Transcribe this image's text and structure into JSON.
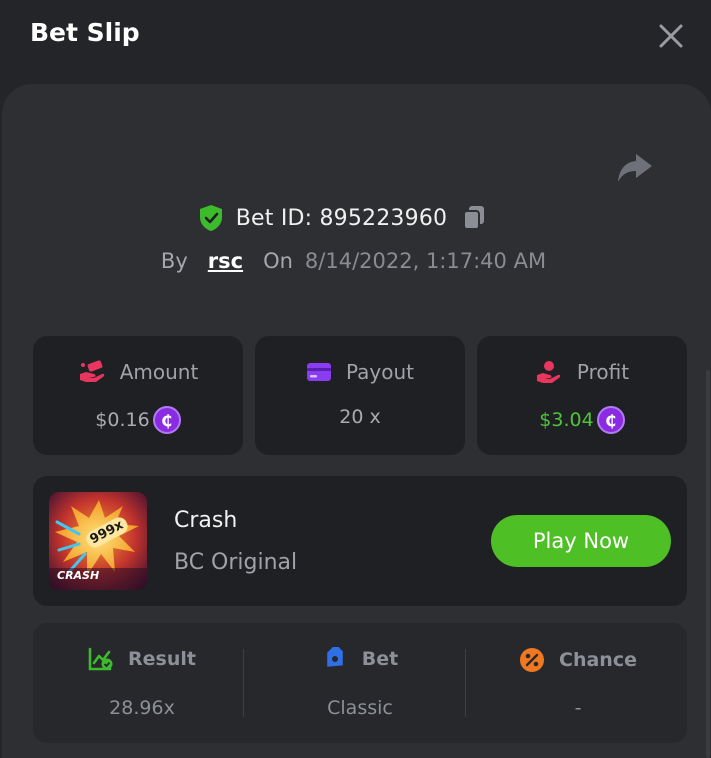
{
  "header": {
    "title": "Bet Slip"
  },
  "bet": {
    "id_text": "Bet ID: 895223960",
    "by_label": "By",
    "user": "rsc",
    "on_label": "On",
    "date": "8/14/2022, 1:17:40 AM"
  },
  "stats": [
    {
      "label": "Amount",
      "value": "$0.16",
      "icon": "money-hand-icon",
      "coin": "₵"
    },
    {
      "label": "Payout",
      "value": "20 x",
      "icon": "card-icon"
    },
    {
      "label": "Profit",
      "value": "$3.04",
      "icon": "profit-hand-icon",
      "coin": "₵"
    }
  ],
  "game": {
    "name": "Crash",
    "subtitle": "BC Original",
    "thumb_badge": "999x",
    "thumb_label": "CRASH",
    "play_label": "Play Now"
  },
  "details": [
    {
      "label": "Result",
      "value": "28.96x",
      "icon": "chart-check-icon"
    },
    {
      "label": "Bet",
      "value": "Classic",
      "icon": "tag-icon"
    },
    {
      "label": "Chance",
      "value": "-",
      "icon": "percent-icon"
    }
  ],
  "colors": {
    "background": "#232528",
    "panel": "#2d2f33",
    "card": "#1f2023",
    "accent_green": "#4fbf26",
    "profit_green": "#4fc43a",
    "coin_purple": "#8a2be2"
  }
}
